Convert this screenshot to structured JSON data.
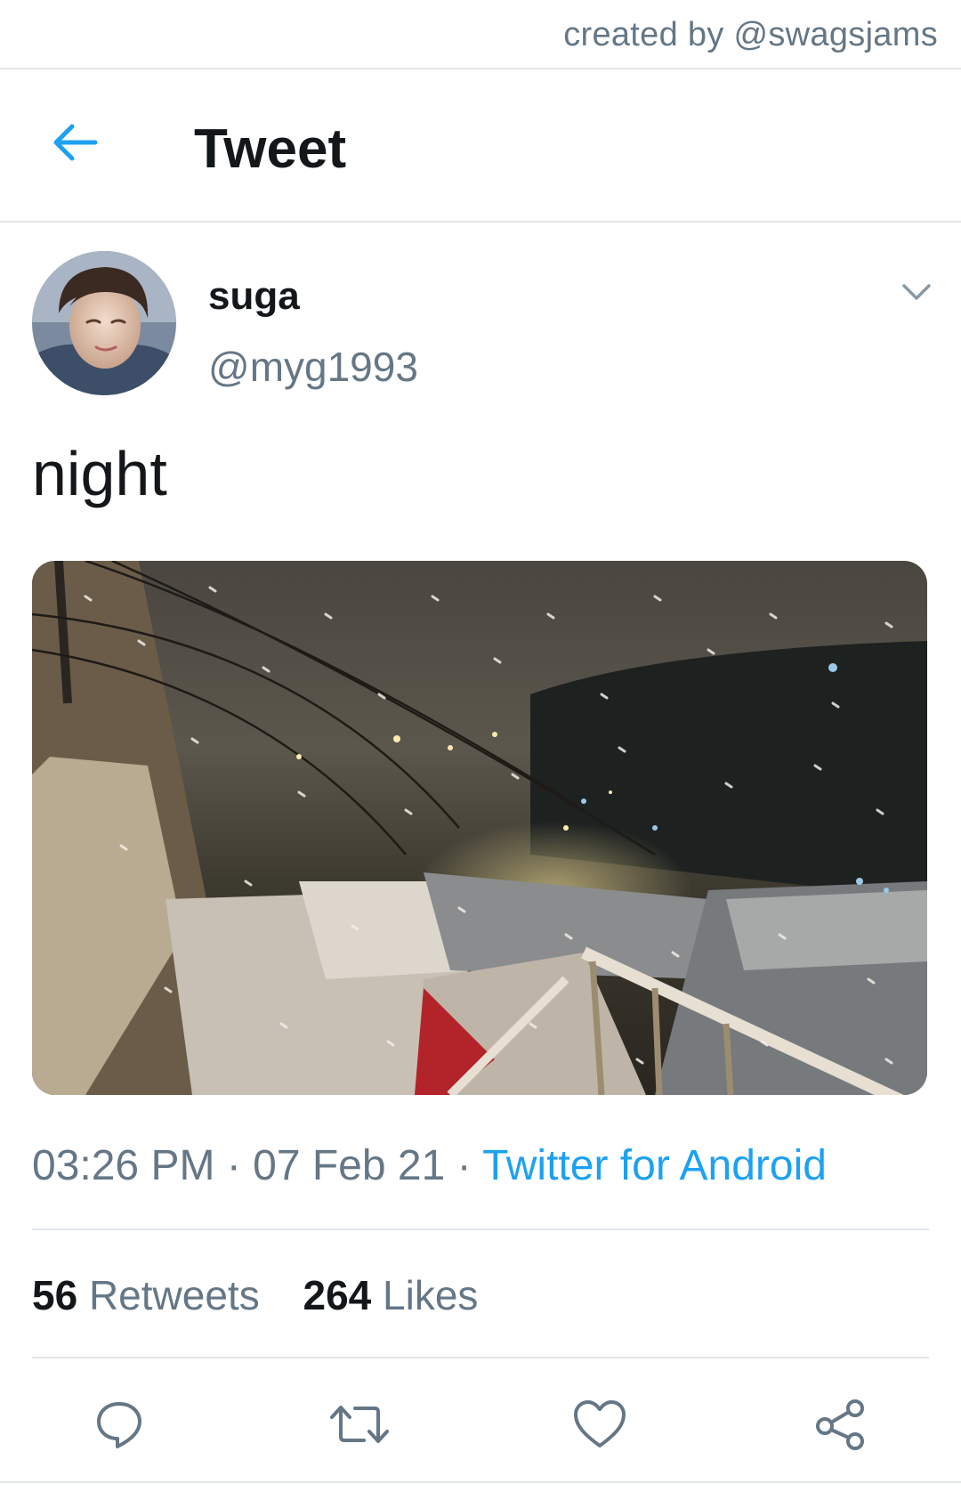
{
  "credit": {
    "text": "created by @swagsjams"
  },
  "header": {
    "title": "Tweet",
    "back_icon": "arrow-left-icon"
  },
  "author": {
    "display_name": "suga",
    "handle": "@myg1993",
    "avatar_icon": "avatar",
    "menu_icon": "chevron-down-icon"
  },
  "tweet": {
    "text": "night",
    "media_icon": "photo-snowy-night-rooftops",
    "time": "03:26 PM",
    "date": "07 Feb 21",
    "separator": "·",
    "source": "Twitter for Android"
  },
  "stats": {
    "retweets_count": "56",
    "retweets_label": "Retweets",
    "likes_count": "264",
    "likes_label": "Likes"
  },
  "actions": {
    "reply_icon": "reply-icon",
    "retweet_icon": "retweet-icon",
    "like_icon": "heart-icon",
    "share_icon": "share-icon"
  },
  "colors": {
    "accent": "#1da1f2",
    "text_primary": "#14171a",
    "text_secondary": "#657786",
    "divider": "#e1e6ea"
  }
}
